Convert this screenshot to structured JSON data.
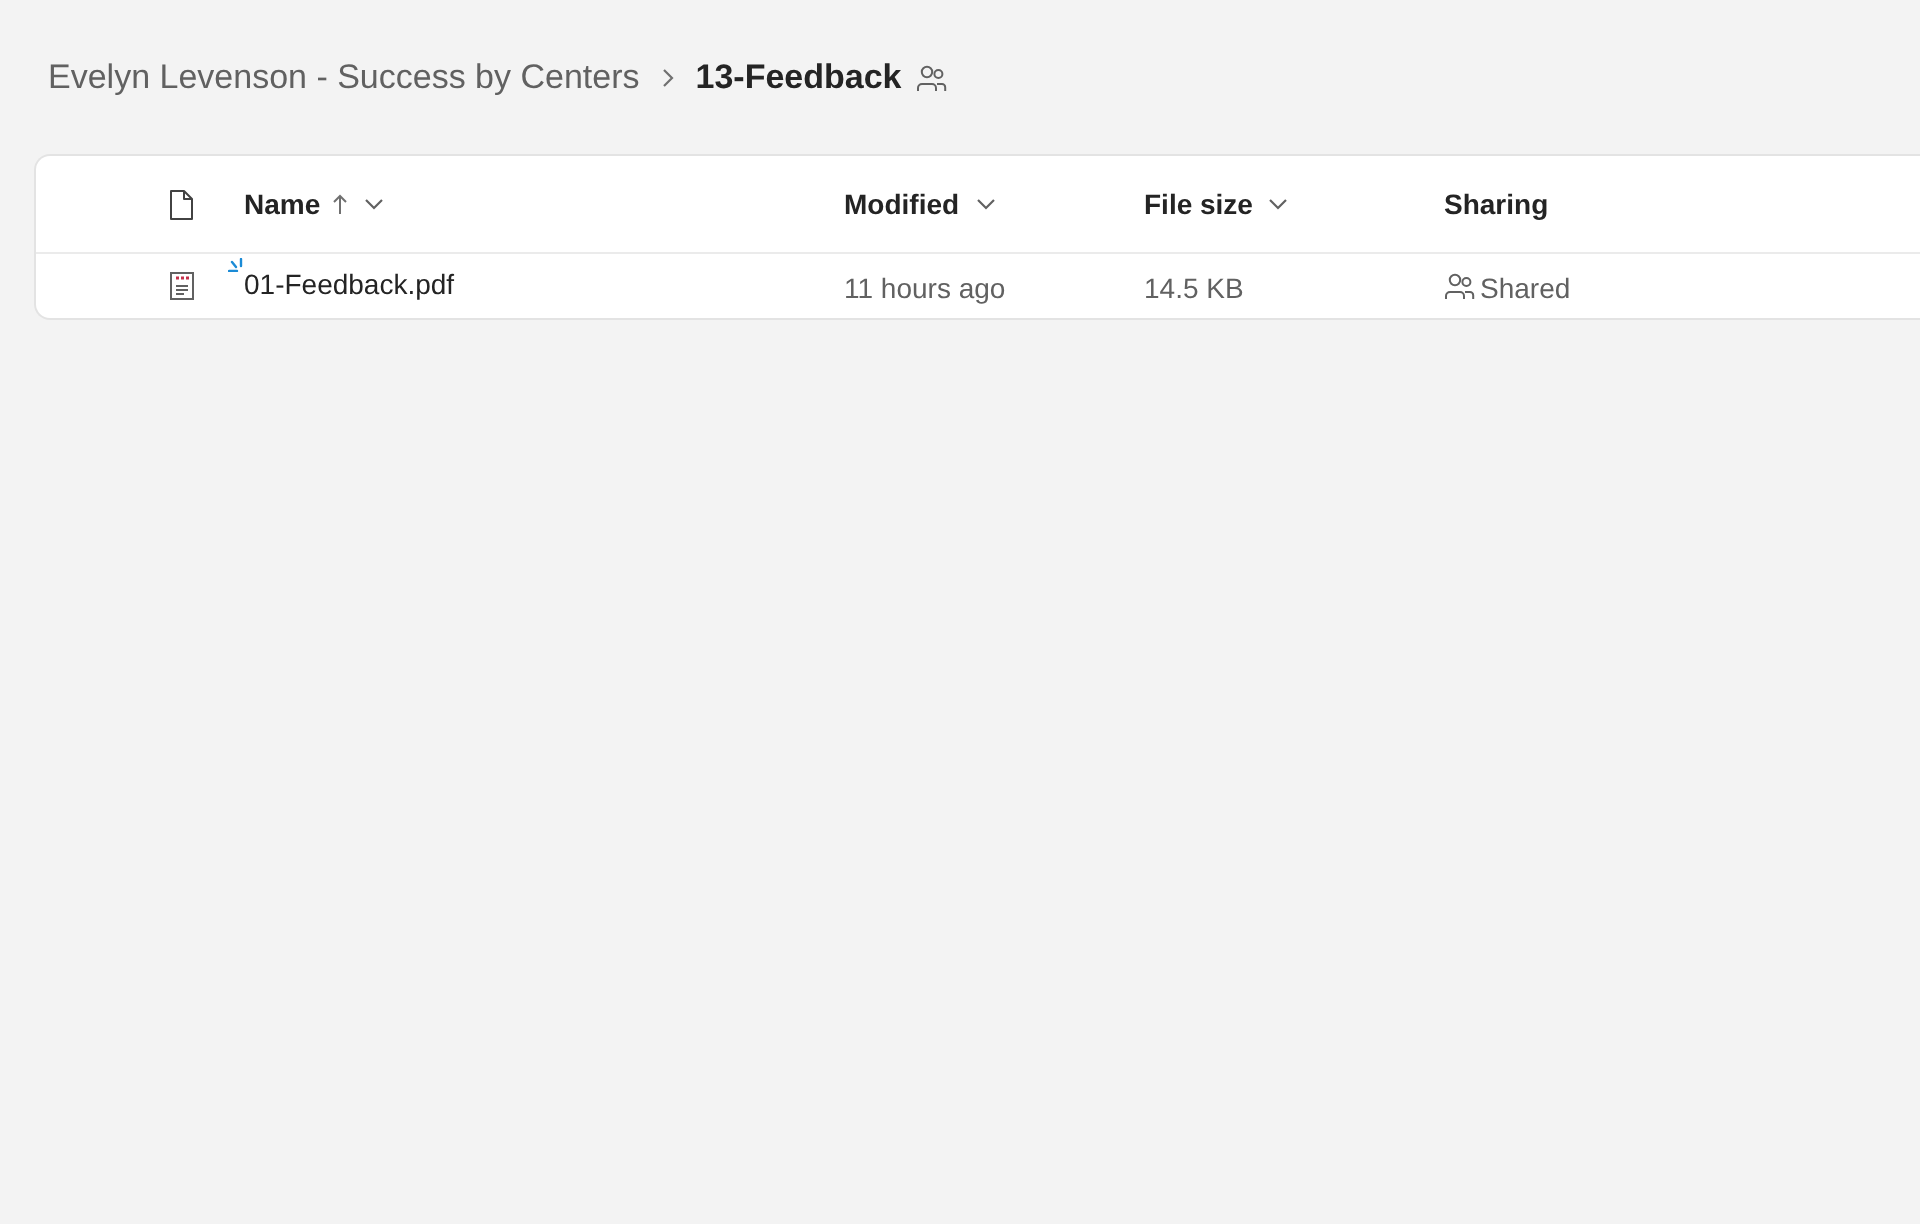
{
  "breadcrumb": {
    "items": [
      {
        "label": "Evelyn Levenson - Success by Centers",
        "current": false
      },
      {
        "label": "13-Feedback",
        "current": true
      }
    ],
    "shared": true
  },
  "table": {
    "columns": [
      {
        "label": "Name",
        "sorted": true,
        "menu": true
      },
      {
        "label": "Modified",
        "sorted": false,
        "menu": true
      },
      {
        "label": "File size",
        "sorted": false,
        "menu": true
      },
      {
        "label": "Sharing",
        "sorted": false,
        "menu": false
      }
    ],
    "rows": [
      {
        "kind": "pdf",
        "name": "01-Feedback.pdf",
        "new": true,
        "modified": "11 hours ago",
        "file_size": "14.5 KB",
        "sharing": "Shared"
      }
    ]
  }
}
